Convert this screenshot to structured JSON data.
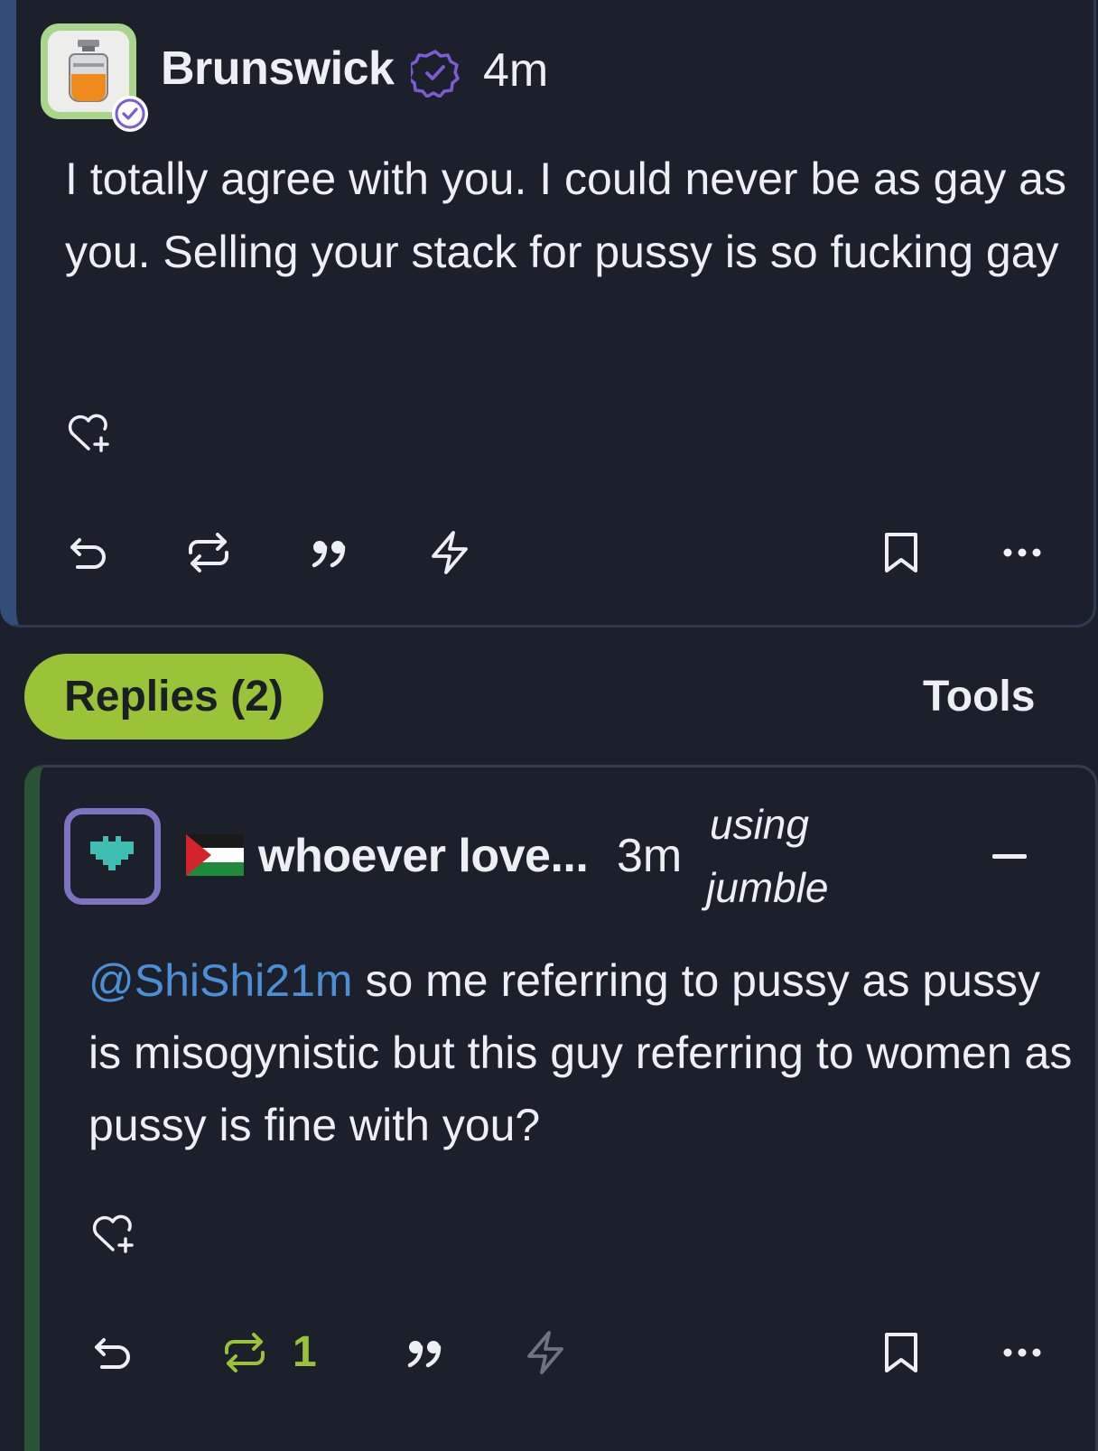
{
  "post": {
    "author": "Brunswick",
    "time": "4m",
    "body": "I totally agree with you. I could never be as gay as you. Selling your stack for pussy is so fucking gay",
    "avatar_icon": "gas-bottle-icon",
    "verified_icon": "verified-badge-icon"
  },
  "tabs": {
    "replies": "Replies (2)",
    "tools": "Tools"
  },
  "reply": {
    "author": "whoever love...",
    "flag_icon": "palestine-flag-icon",
    "time": "3m",
    "client_line1": "using",
    "client_line2": "jumble",
    "mention": "@ShiShi21m",
    "body": " so me referring to pussy as pussy is misogynistic but this guy referring to women as pussy is fine with you?",
    "repost_count": "1"
  },
  "colors": {
    "background": "#1b202b",
    "accent_green": "#9bc338",
    "mention_blue": "#4d8fd6",
    "verified_purple": "#7c5cd6",
    "avatar_border": "#7c73c3",
    "post_border": "#314d78",
    "reply_border": "#295236"
  }
}
